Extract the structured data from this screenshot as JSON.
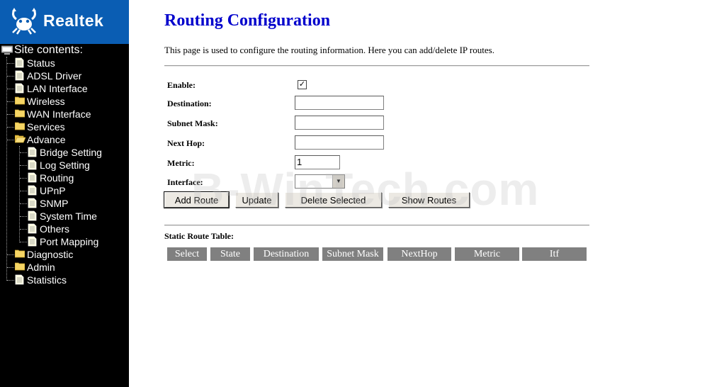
{
  "brand": {
    "name": "Realtek"
  },
  "sidebar": {
    "root_label": "Site contents:",
    "items": [
      {
        "label": "Status",
        "icon": "page-icon"
      },
      {
        "label": "ADSL Driver",
        "icon": "page-icon"
      },
      {
        "label": "LAN Interface",
        "icon": "page-icon"
      },
      {
        "label": "Wireless",
        "icon": "folder-icon"
      },
      {
        "label": "WAN Interface",
        "icon": "folder-icon"
      },
      {
        "label": "Services",
        "icon": "folder-icon"
      },
      {
        "label": "Advance",
        "icon": "open-folder-icon"
      },
      {
        "label": "Bridge Setting",
        "icon": "page-icon"
      },
      {
        "label": "Log Setting",
        "icon": "page-icon"
      },
      {
        "label": "Routing",
        "icon": "page-icon"
      },
      {
        "label": "UPnP",
        "icon": "page-icon"
      },
      {
        "label": "SNMP",
        "icon": "page-icon"
      },
      {
        "label": "System Time",
        "icon": "page-icon"
      },
      {
        "label": "Others",
        "icon": "page-icon"
      },
      {
        "label": "Port Mapping",
        "icon": "page-icon"
      },
      {
        "label": "Diagnostic",
        "icon": "folder-icon"
      },
      {
        "label": "Admin",
        "icon": "folder-icon"
      },
      {
        "label": "Statistics",
        "icon": "page-icon"
      }
    ]
  },
  "main": {
    "title": "Routing Configuration",
    "description": "This page is used to configure the routing information. Here you can add/delete IP routes.",
    "form": {
      "enable_label": "Enable:",
      "enable_checked": "✓",
      "destination_label": "Destination:",
      "destination_value": "",
      "subnet_label": "Subnet Mask:",
      "subnet_value": "",
      "nexthop_label": "Next Hop:",
      "nexthop_value": "",
      "metric_label": "Metric:",
      "metric_value": "1",
      "interface_label": "Interface:",
      "interface_value": ""
    },
    "buttons": {
      "add": "Add Route",
      "update": "Update",
      "delete": "Delete Selected",
      "show": "Show Routes"
    },
    "table": {
      "title": "Static Route Table:",
      "columns": [
        "Select",
        "State",
        "Destination",
        "Subnet Mask",
        "NextHop",
        "Metric",
        "Itf"
      ]
    }
  },
  "watermark": "B-WinTech.com",
  "colors": {
    "title": "#0000cc",
    "logo_bg": "#0a5db3",
    "sidebar_bg": "#000000",
    "table_header_bg": "#808080"
  }
}
